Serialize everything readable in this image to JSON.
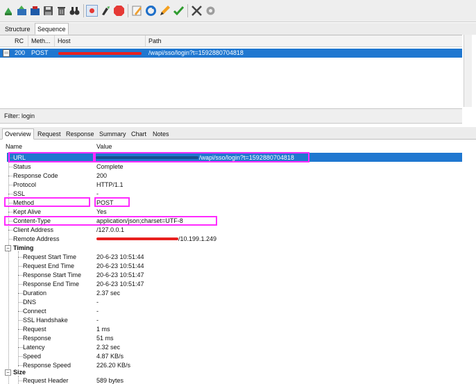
{
  "toolbar": {
    "icons": [
      "clear-icon",
      "import-icon",
      "tools-icon",
      "save-icon",
      "trash-icon",
      "binoculars-icon",
      "record-icon",
      "broom-icon",
      "stop-icon",
      "edit-icon",
      "refresh-icon",
      "pencil-icon",
      "validate-icon",
      "settings-icon",
      "gear-icon"
    ]
  },
  "top_tabs": [
    "Structure",
    "Sequence"
  ],
  "grid": {
    "columns": [
      "RC",
      "Meth...",
      "Host",
      "Path"
    ],
    "rows": [
      {
        "rc": "200",
        "method": "POST",
        "host": "",
        "path": "/wapi/sso/login?t=1592880704818"
      }
    ]
  },
  "filter": {
    "label": "Filter:",
    "value": "login"
  },
  "detail_tabs": [
    "Overview",
    "Request",
    "Response",
    "Summary",
    "Chart",
    "Notes"
  ],
  "detail_columns": {
    "name": "Name",
    "value": "Value"
  },
  "overview": {
    "url": {
      "label": "URL",
      "value": "/wapi/sso/login?t=1592880704818"
    },
    "status": {
      "label": "Status",
      "value": "Complete"
    },
    "response_code": {
      "label": "Response Code",
      "value": "200"
    },
    "protocol": {
      "label": "Protocol",
      "value": "HTTP/1.1"
    },
    "ssl": {
      "label": "SSL",
      "value": "-"
    },
    "method": {
      "label": "Method",
      "value": "POST"
    },
    "kept_alive": {
      "label": "Kept Alive",
      "value": "Yes"
    },
    "content_type": {
      "label": "Content-Type",
      "value": "application/json;charset=UTF-8"
    },
    "client_address": {
      "label": "Client Address",
      "value": "/127.0.0.1"
    },
    "remote_address": {
      "label": "Remote Address",
      "value": "/10.199.1.249"
    }
  },
  "timing": {
    "label": "Timing",
    "request_start_time": {
      "label": "Request Start Time",
      "value": "20-6-23 10:51:44"
    },
    "request_end_time": {
      "label": "Request End Time",
      "value": "20-6-23 10:51:44"
    },
    "response_start_time": {
      "label": "Response Start Time",
      "value": "20-6-23 10:51:47"
    },
    "response_end_time": {
      "label": "Response End Time",
      "value": "20-6-23 10:51:47"
    },
    "duration": {
      "label": "Duration",
      "value": "2.37 sec"
    },
    "dns": {
      "label": "DNS",
      "value": "-"
    },
    "connect": {
      "label": "Connect",
      "value": "-"
    },
    "ssl_handshake": {
      "label": "SSL Handshake",
      "value": "-"
    },
    "request": {
      "label": "Request",
      "value": "1 ms"
    },
    "response": {
      "label": "Response",
      "value": "51 ms"
    },
    "latency": {
      "label": "Latency",
      "value": "2.32 sec"
    },
    "speed": {
      "label": "Speed",
      "value": "4.87 KB/s"
    },
    "response_speed": {
      "label": "Response Speed",
      "value": "226.20 KB/s"
    }
  },
  "size": {
    "label": "Size",
    "request_header": {
      "label": "Request Header",
      "value": "589 bytes"
    }
  },
  "colors": {
    "selection": "#1f77d0",
    "highlight_box": "#ff2bff",
    "redaction": "#e8201f"
  }
}
